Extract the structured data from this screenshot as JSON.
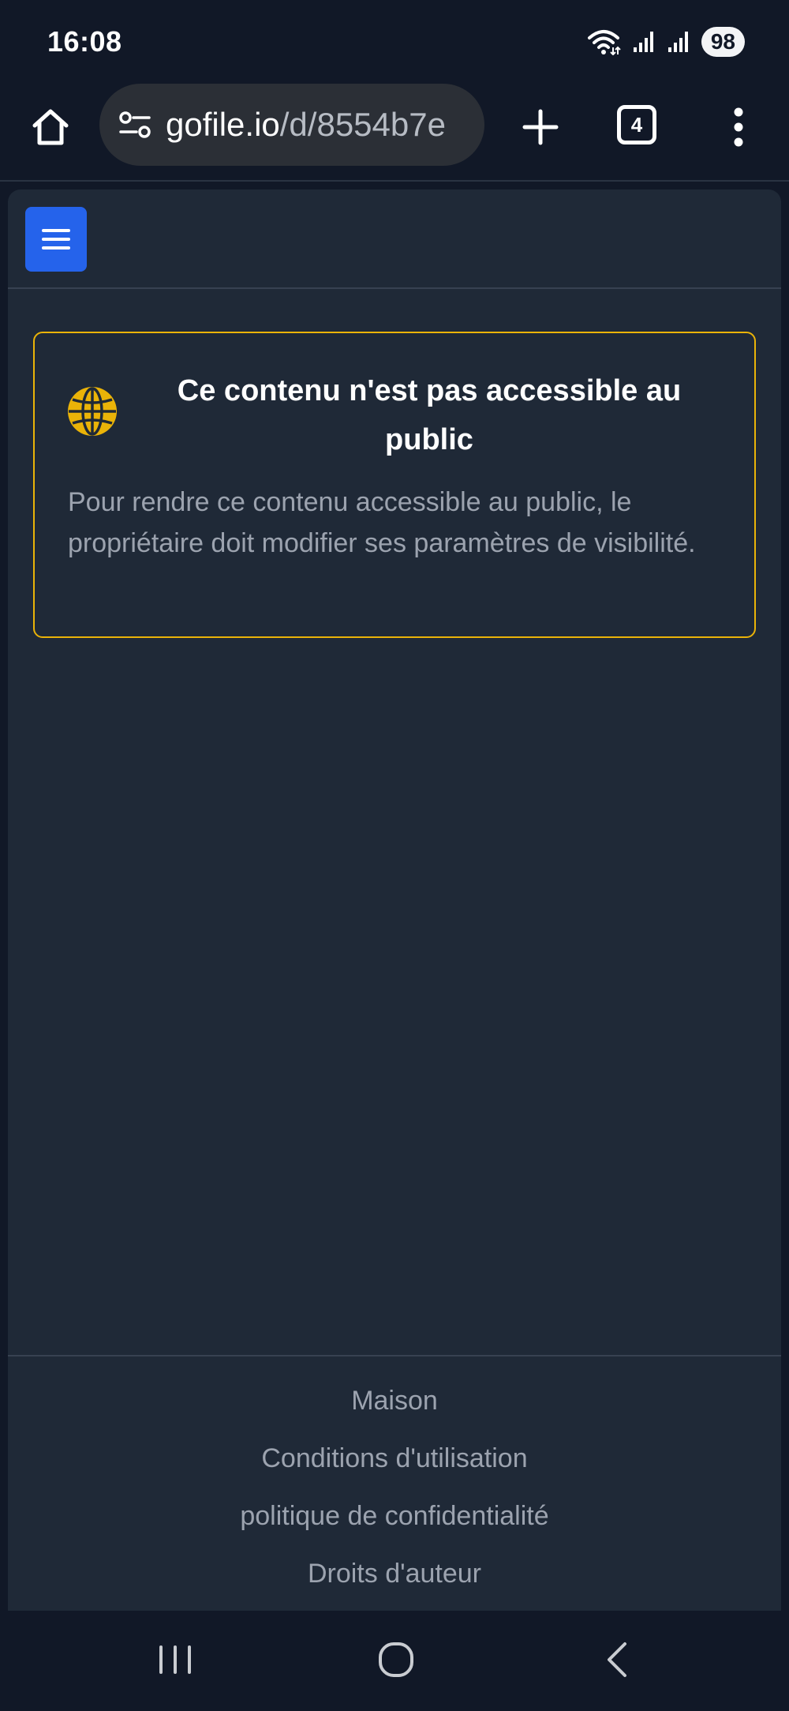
{
  "status_bar": {
    "time": "16:08",
    "battery": "98",
    "icons": [
      "wifi-icon",
      "signal-icon",
      "signal-icon"
    ]
  },
  "browser": {
    "url_domain": "gofile.io",
    "url_path": "/d/8554b7e",
    "tab_count": "4",
    "icons": [
      "home-icon",
      "site-settings-icon",
      "plus-icon",
      "more-vert-icon"
    ]
  },
  "page": {
    "notice": {
      "icon": "globe-icon",
      "title": "Ce contenu n'est pas accessible au public",
      "body": "Pour rendre ce contenu accessible au public, le propriétaire doit modifier ses paramètres de visibilité."
    },
    "footer": {
      "links": [
        {
          "label": "Maison"
        },
        {
          "label": "Conditions d'utilisation"
        },
        {
          "label": "politique de confidentialité"
        },
        {
          "label": "Droits d'auteur"
        }
      ]
    }
  },
  "colors": {
    "background": "#111827",
    "page": "#1f2937",
    "accent_blue": "#2563eb",
    "warning_yellow": "#eab308",
    "muted_text": "#9ca3af"
  }
}
